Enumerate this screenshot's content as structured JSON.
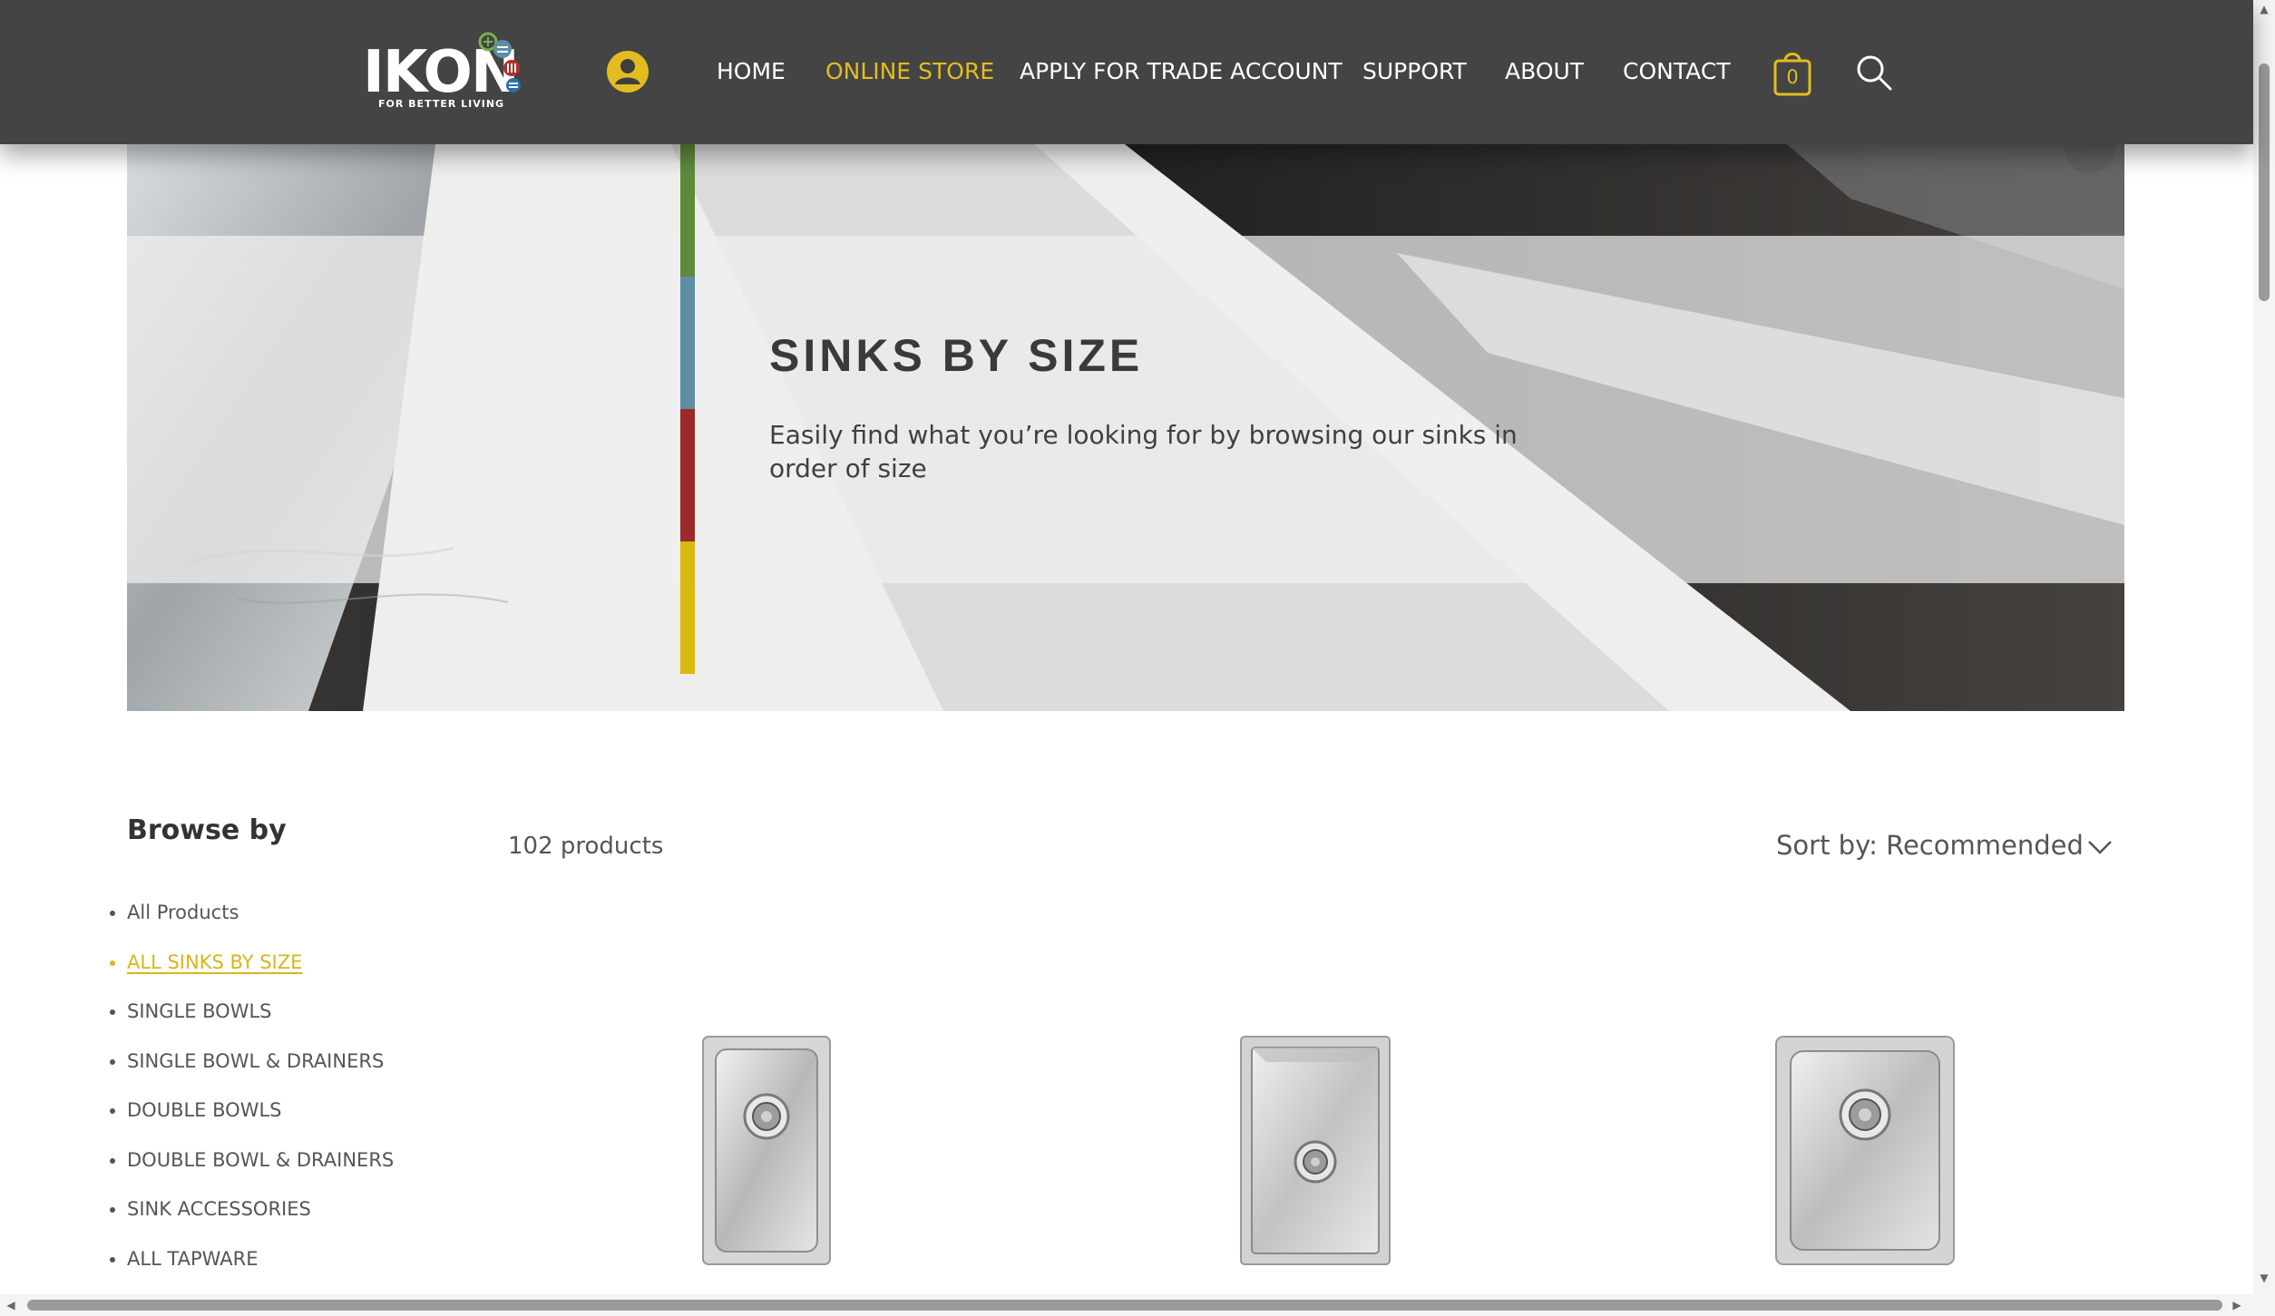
{
  "brand": {
    "logo_text": "IKON",
    "tagline": "FOR BETTER LIVING",
    "accent": "#e3bd1f",
    "header_bg": "#444444"
  },
  "nav": {
    "items": [
      {
        "label": "HOME",
        "active": false
      },
      {
        "label": "ONLINE STORE",
        "active": true
      },
      {
        "label": "APPLY FOR TRADE ACCOUNT",
        "active": false
      },
      {
        "label": "SUPPORT",
        "active": false
      },
      {
        "label": "ABOUT",
        "active": false
      },
      {
        "label": "CONTACT",
        "active": false
      }
    ],
    "cart_count": "0",
    "icons": {
      "user": "user-icon",
      "cart": "shopping-bag-icon",
      "search": "search-icon"
    }
  },
  "hero": {
    "title": "SINKS BY SIZE",
    "subtitle": "Easily find what you’re looking for by browsing our sinks in order of size",
    "stripe_colors": [
      "#5f8a3a",
      "#5d8ea3",
      "#9b2b28",
      "#d9b80f"
    ]
  },
  "sidebar": {
    "title": "Browse by",
    "items": [
      {
        "label": "All Products",
        "active": false
      },
      {
        "label": "ALL SINKS BY SIZE",
        "active": true
      },
      {
        "label": "SINGLE BOWLS",
        "active": false
      },
      {
        "label": "SINGLE BOWL & DRAINERS",
        "active": false
      },
      {
        "label": "DOUBLE BOWLS",
        "active": false
      },
      {
        "label": "DOUBLE BOWL & DRAINERS",
        "active": false
      },
      {
        "label": "SINK ACCESSORIES",
        "active": false
      },
      {
        "label": "ALL TAPWARE",
        "active": false
      }
    ]
  },
  "products": {
    "count_label": "102 products",
    "sort_label": "Sort by: Recommended",
    "sort_icon": "chevron-down-icon"
  }
}
